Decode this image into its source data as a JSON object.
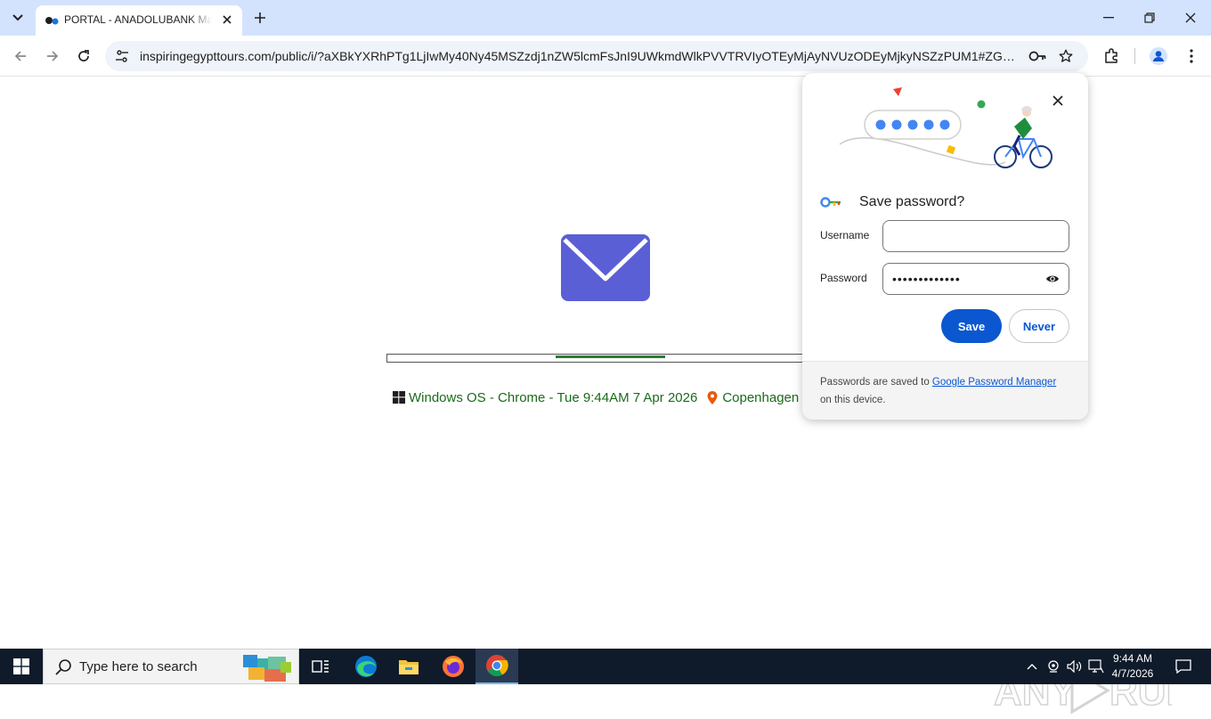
{
  "browser": {
    "tab": {
      "title": "PORTAL - ANADOLUBANK Mail"
    },
    "url": "inspiringegypttours.com/public/i/?aXBkYXRhPTg1LjIwMy40Ny45MSZzdj1nZW5lcmFsJnI9UWkmdWlkPVVTRVIyOTEyMjAyNVUzODEyMjkyNSZzPUM1#ZGFuaXN..."
  },
  "page": {
    "os_text": "Windows OS - Chrome - Tue 9:44AM 7 Apr 2026",
    "location_text": "Copenhagen ,",
    "progress_fraction": 0.25
  },
  "password_bubble": {
    "title": "Save password?",
    "username_label": "Username",
    "username_value": "",
    "password_label": "Password",
    "password_value": "•••••••••••••",
    "save_label": "Save",
    "never_label": "Never",
    "footer_prefix": "Passwords are saved to ",
    "footer_link": "Google Password Manager",
    "footer_suffix": "on this device."
  },
  "taskbar": {
    "search_placeholder": "Type here to search",
    "time": "9:44 AM",
    "date": "4/7/2026",
    "apps": [
      "task-view-icon",
      "edge-icon",
      "file-explorer-icon",
      "firefox-icon",
      "chrome-icon"
    ]
  },
  "colors": {
    "tabstrip_bg": "#d3e3fd",
    "mail_icon": "#5b5fd6",
    "progress_green": "#2e7d32",
    "info_text_green": "#1a6b1a",
    "primary_blue": "#0b57d0",
    "taskbar_bg": "#0f1a2a"
  }
}
